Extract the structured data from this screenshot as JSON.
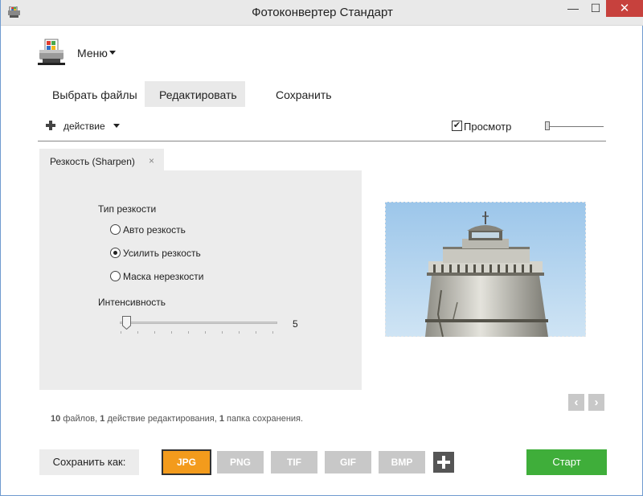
{
  "window": {
    "title": "Фотоконвертер Стандарт",
    "minimize": "—",
    "maximize": "☐",
    "close": "✕"
  },
  "menu": {
    "label": "Меню"
  },
  "tabs": [
    {
      "label": "Выбрать файлы"
    },
    {
      "label": "Редактировать"
    },
    {
      "label": "Сохранить"
    }
  ],
  "toolbar": {
    "action_label": "действие",
    "preview_label": "Просмотр",
    "preview_checked": true,
    "checkmark": "✔"
  },
  "effect_tab": {
    "label": "Резкость (Sharpen)",
    "close": "×"
  },
  "sharpen": {
    "type_label": "Тип резкости",
    "options": [
      {
        "label": "Авто резкость",
        "selected": false
      },
      {
        "label": "Усилить резкость",
        "selected": true
      },
      {
        "label": "Маска нерезкости",
        "selected": false
      }
    ],
    "intensity_label": "Интенсивность",
    "intensity_value": "5"
  },
  "navigation": {
    "prev": "‹",
    "next": "›"
  },
  "status": {
    "files_count": "10",
    "files_text": "файлов,",
    "actions_count": "1",
    "actions_text": "действие редактирования,",
    "folders_count": "1",
    "folders_text": "папка сохранения."
  },
  "save_as": {
    "label": "Сохранить как:",
    "formats": [
      {
        "label": "JPG",
        "selected": true
      },
      {
        "label": "PNG"
      },
      {
        "label": "TIF"
      },
      {
        "label": "GIF"
      },
      {
        "label": "BMP"
      }
    ]
  },
  "start_button": "Старт",
  "colors": {
    "accent_format": "#f39b1c",
    "start": "#3fae3a",
    "close": "#c7413d",
    "panel": "#ececec"
  }
}
